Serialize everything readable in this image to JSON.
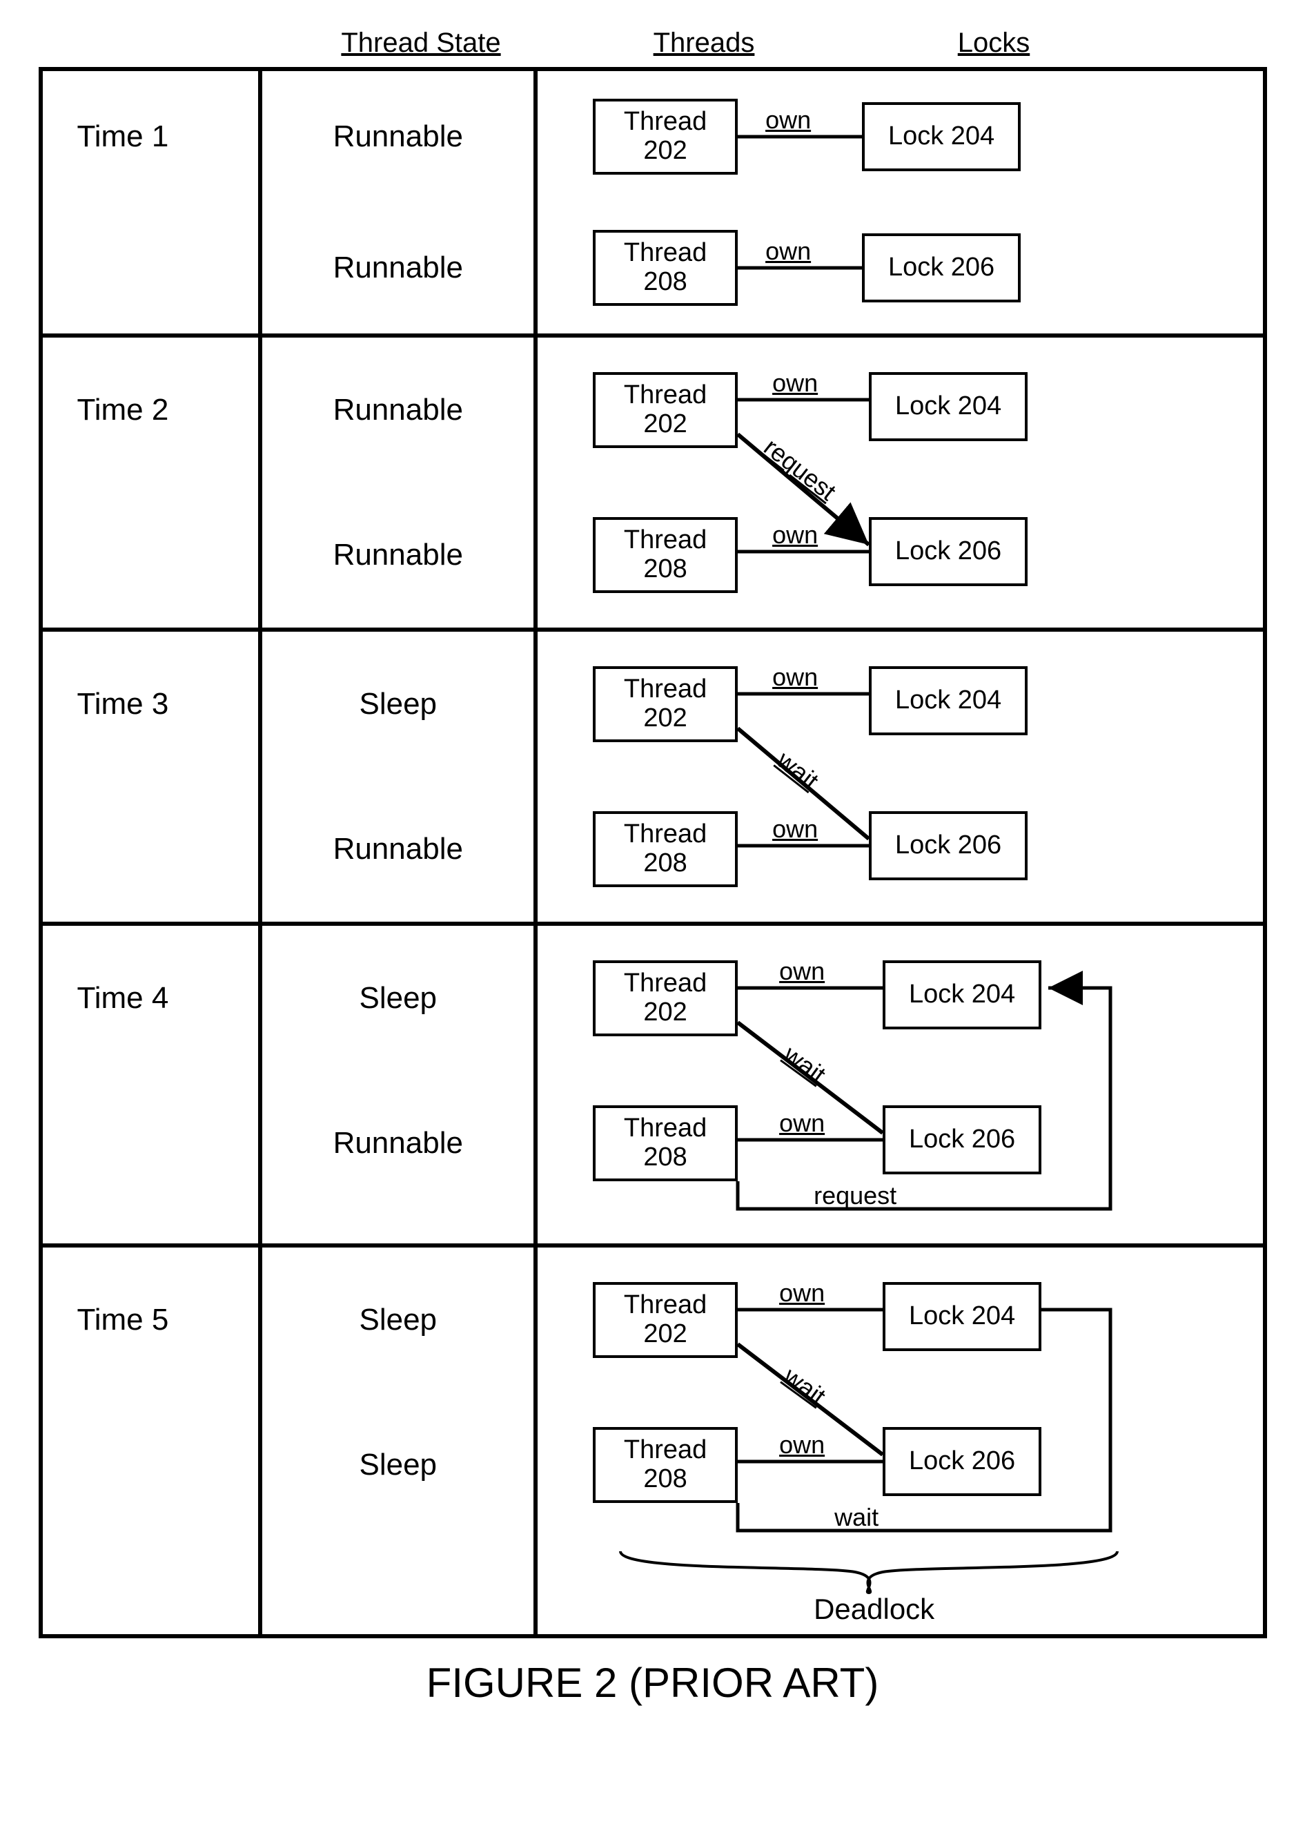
{
  "headers": {
    "state": "Thread State",
    "threads": "Threads",
    "locks": "Locks"
  },
  "caption": "FIGURE 2 (PRIOR ART)",
  "cells": {
    "time1": "Time 1",
    "time2": "Time 2",
    "time3": "Time 3",
    "time4": "Time 4",
    "time5": "Time 5",
    "runnable": "Runnable",
    "sleep": "Sleep"
  },
  "boxes": {
    "thread202a": "Thread",
    "thread202b": "202",
    "thread208a": "Thread",
    "thread208b": "208",
    "lock204": "Lock 204",
    "lock206": "Lock 206"
  },
  "edges": {
    "own": "own",
    "request": "request",
    "wait": "wait",
    "deadlock": "Deadlock"
  }
}
